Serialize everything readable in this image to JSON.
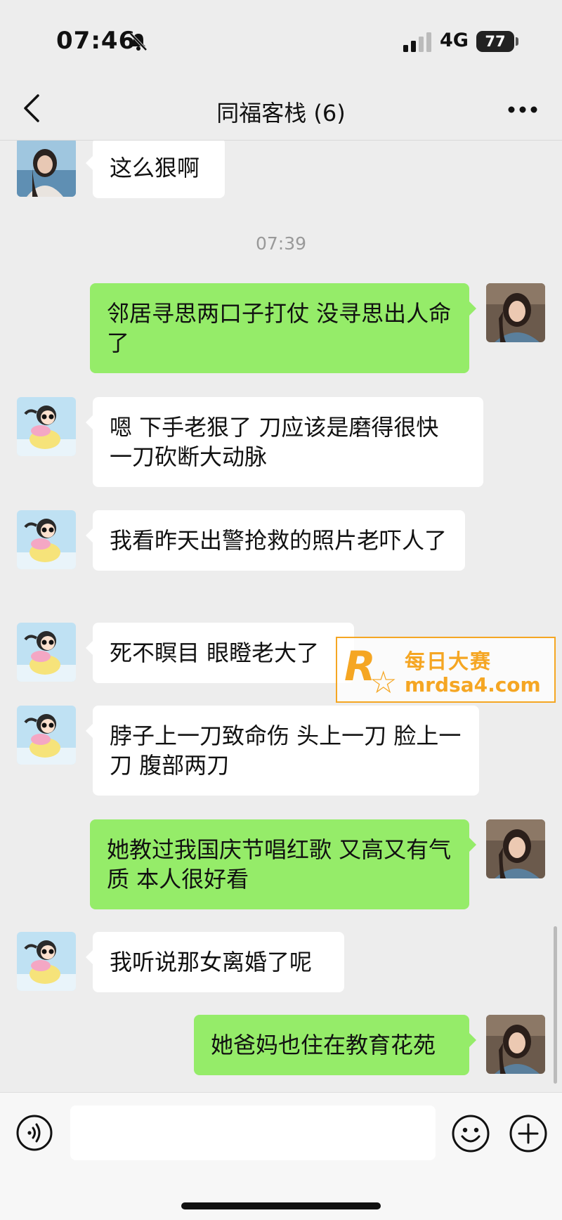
{
  "status_bar": {
    "time": "07:46",
    "network": "4G",
    "battery": "77"
  },
  "nav": {
    "title": "同福客栈 (6)"
  },
  "messages": [
    {
      "side": "other",
      "avatar": "girl-photo-avatar",
      "text": "这么狠啊"
    },
    {
      "type": "time",
      "text": "07:39"
    },
    {
      "side": "me",
      "avatar": "woman-photo-avatar",
      "text": "邻居寻思两口子打仗 没寻思出人命了"
    },
    {
      "side": "other",
      "avatar": "cartoon-girl-avatar",
      "text": "嗯 下手老狠了 刀应该是磨得很快 一刀砍断大动脉"
    },
    {
      "side": "other",
      "avatar": "cartoon-girl-avatar",
      "text": "我看昨天出警抢救的照片老吓人了"
    },
    {
      "side": "other",
      "avatar": "cartoon-girl-avatar",
      "text": "死不瞑目 眼瞪老大了"
    },
    {
      "side": "other",
      "avatar": "cartoon-girl-avatar",
      "text": "脖子上一刀致命伤 头上一刀 脸上一刀 腹部两刀"
    },
    {
      "side": "me",
      "avatar": "woman-photo-avatar",
      "text": "她教过我国庆节唱红歌 又高又有气质 本人很好看"
    },
    {
      "side": "other",
      "avatar": "cartoon-girl-avatar",
      "text": "我听说那女离婚了呢"
    },
    {
      "side": "me",
      "avatar": "woman-photo-avatar",
      "text": "她爸妈也住在教育花苑"
    }
  ],
  "watermark": {
    "letter": "R",
    "brand_cn": "每日大赛",
    "url": "mrdsa4.com"
  },
  "input_bar": {
    "placeholder": ""
  },
  "icons": [
    "bell-muted-icon",
    "signal-icon",
    "back-chevron-icon",
    "more-icon",
    "voice-icon",
    "emoji-icon",
    "plus-icon"
  ],
  "colors": {
    "background": "#ededed",
    "my_bubble": "#95ec69",
    "their_bubble": "#ffffff",
    "watermark": "#f5a623"
  }
}
